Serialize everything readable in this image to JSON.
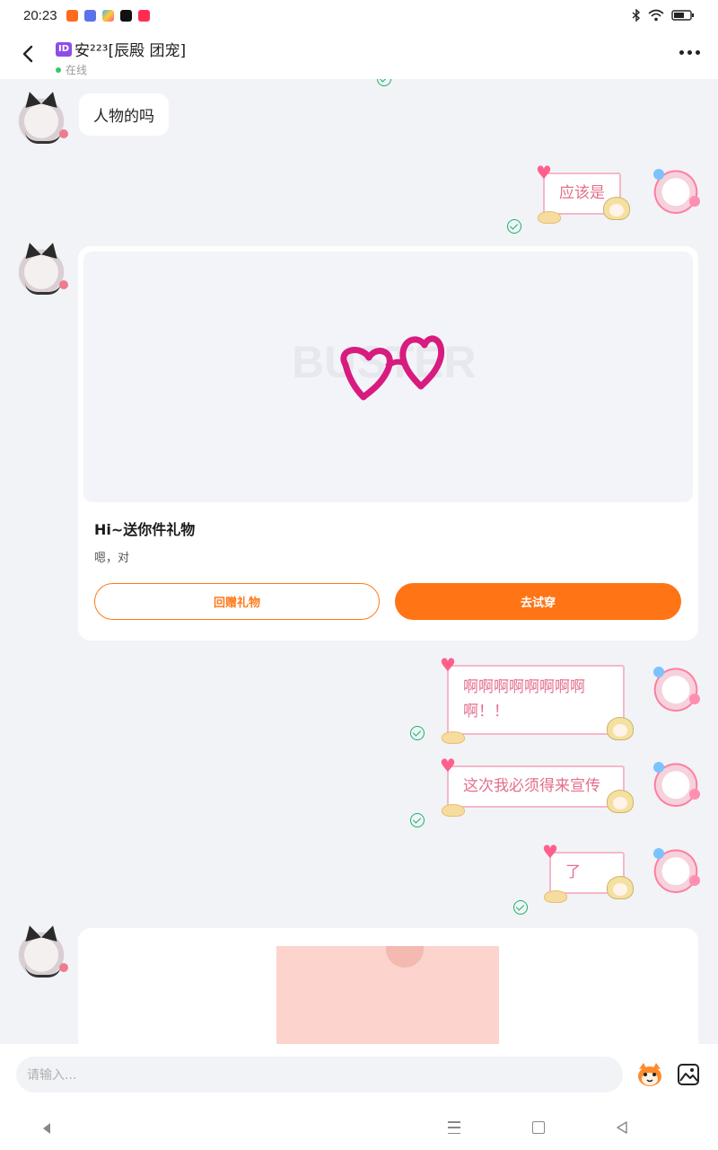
{
  "status_bar": {
    "time": "20:23",
    "app_icons": [
      {
        "name": "app-icon-orange",
        "color": "#ff6a1f"
      },
      {
        "name": "app-icon-blue-bot",
        "color": "#5a73e8"
      },
      {
        "name": "app-icon-colorful",
        "color": "#3db6ff"
      },
      {
        "name": "app-icon-black",
        "color": "#111111"
      },
      {
        "name": "app-icon-red",
        "color": "#ff2d55"
      }
    ]
  },
  "header": {
    "id_badge": "ID",
    "title": "安²²³[辰殿  团宠]",
    "status": "在线"
  },
  "messages": {
    "m1": "人物的吗",
    "m2": "应该是",
    "m4": "啊啊啊啊啊啊啊啊啊！！",
    "m5": "这次我必须得来宣传",
    "m6": "了"
  },
  "gift_card": {
    "title": "Hi~送你件礼物",
    "subtitle": "嗯，对",
    "return_gift_label": "回赠礼物",
    "try_on_label": "去试穿"
  },
  "input": {
    "placeholder": "请输入..."
  },
  "colors": {
    "accent": "#ff7415",
    "read_check": "#16b36a",
    "bubble_text": "#e36f8d"
  }
}
